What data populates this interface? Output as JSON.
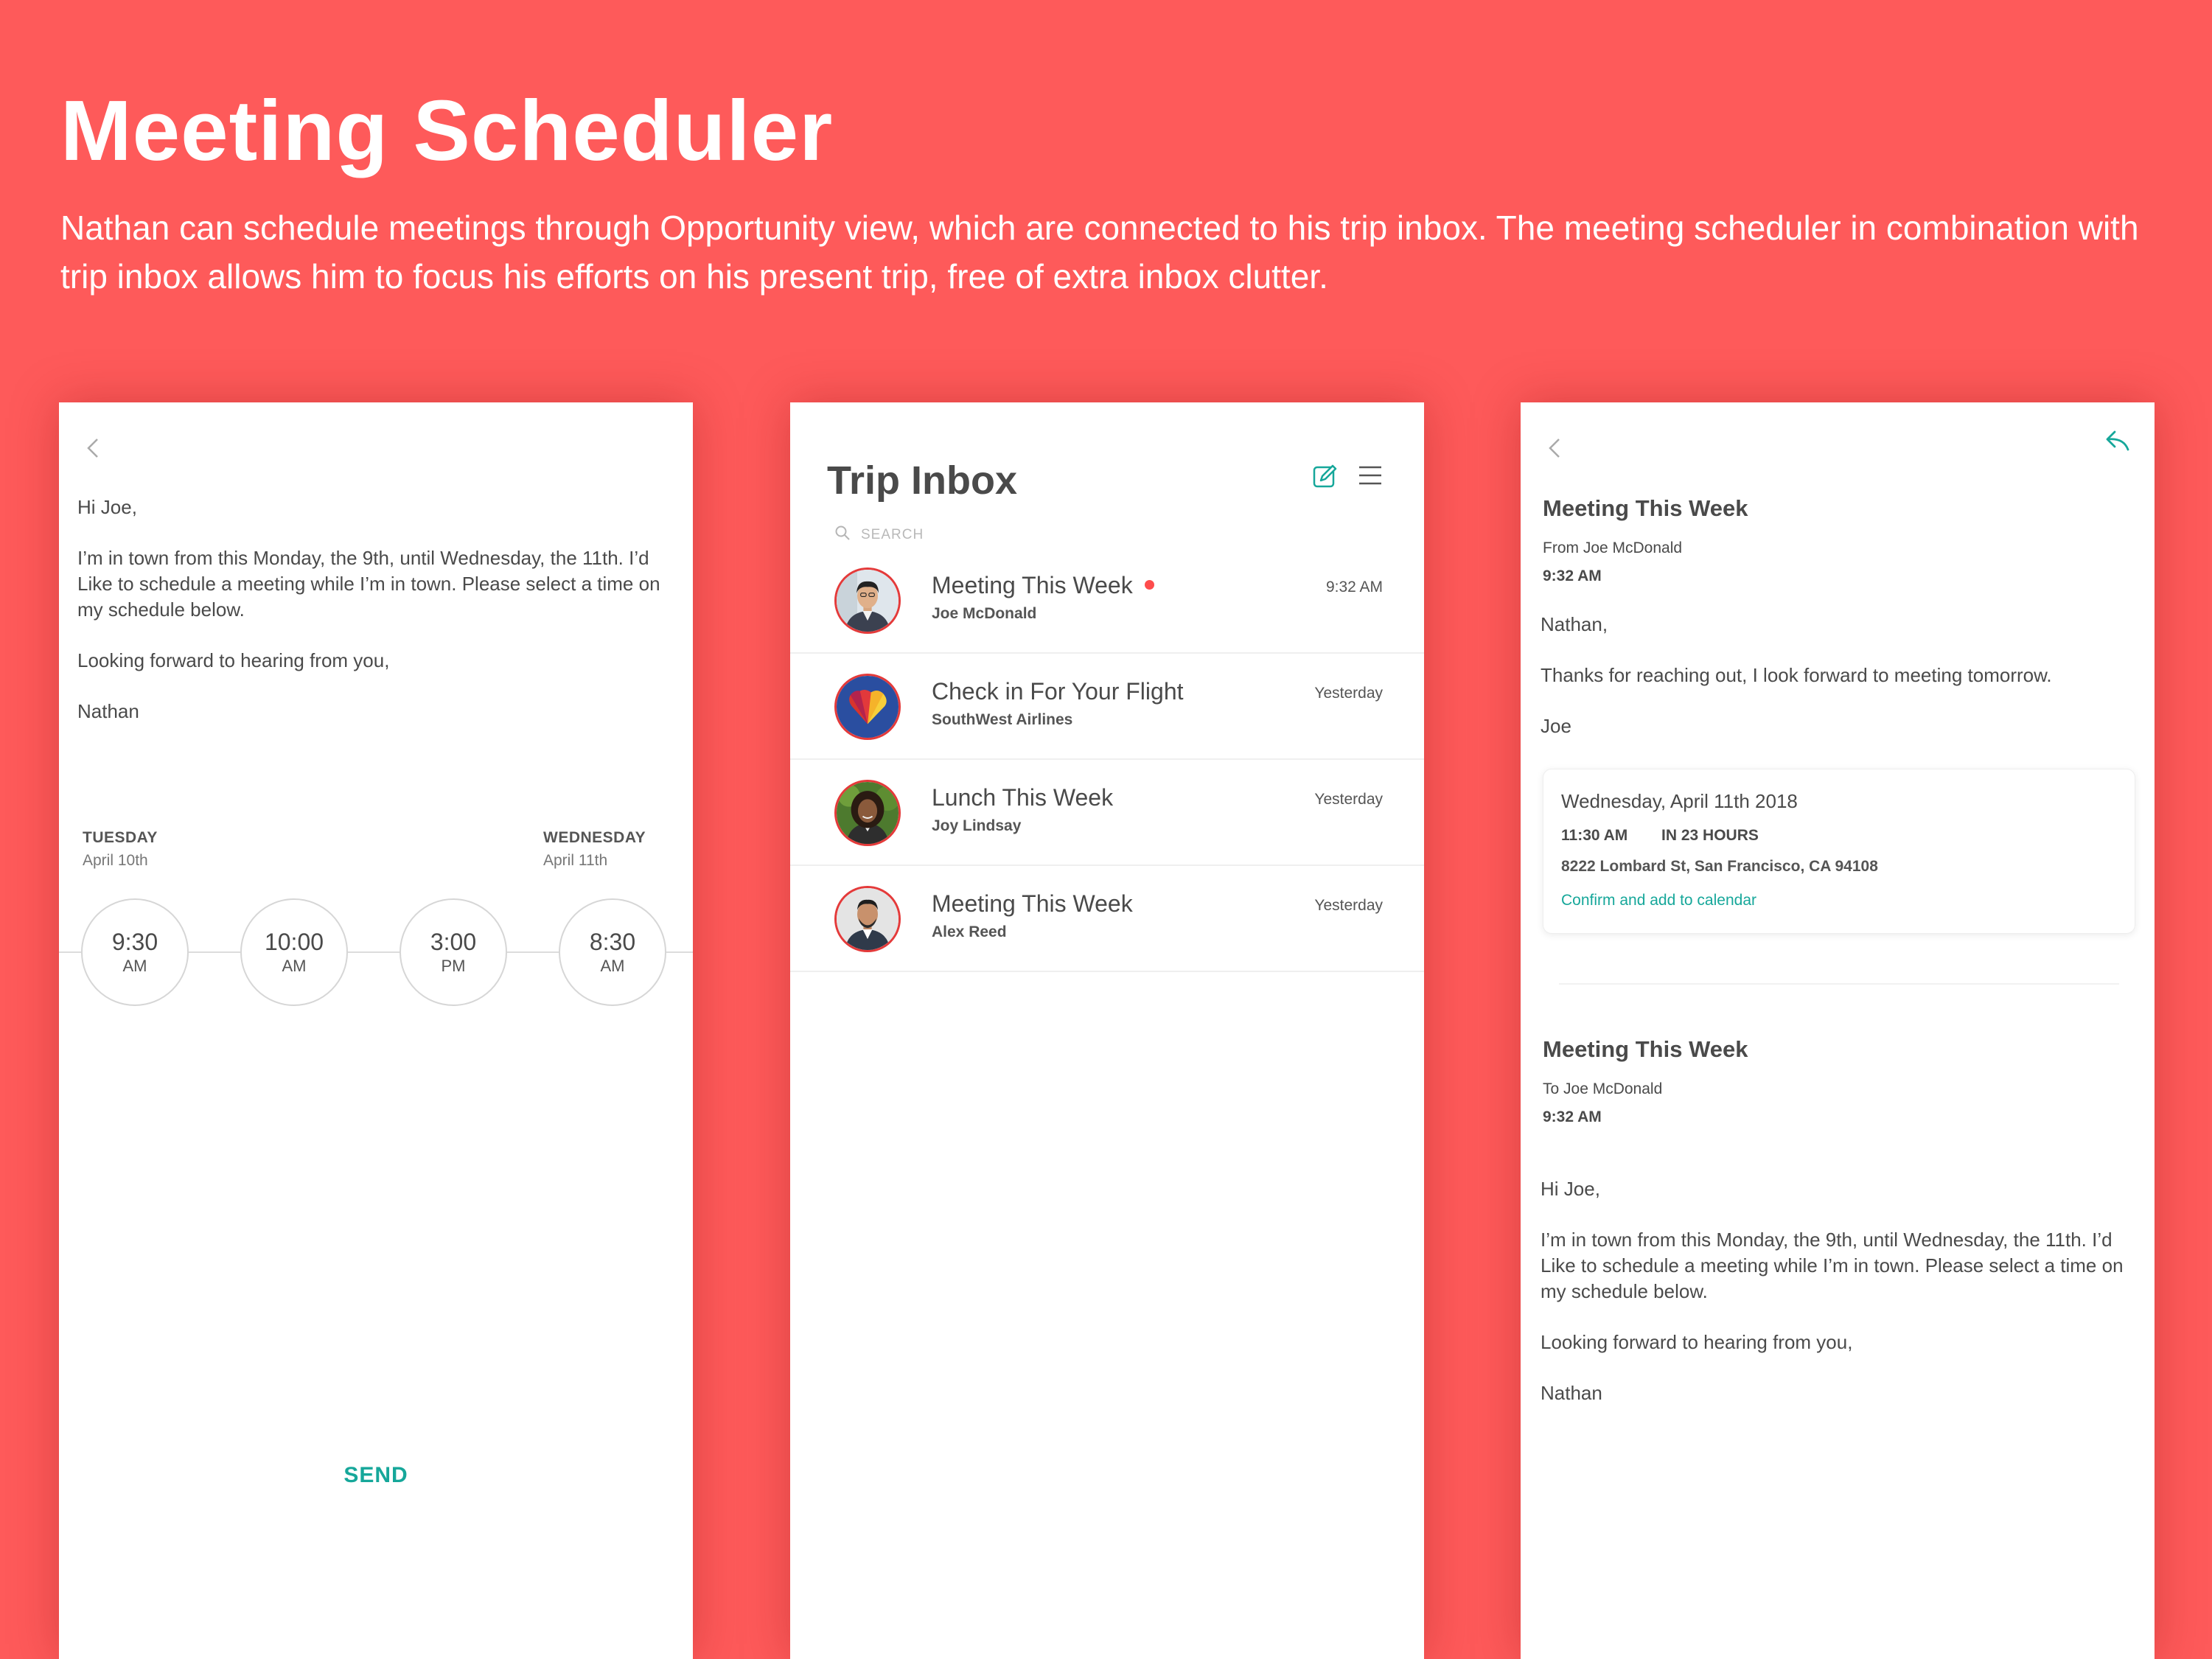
{
  "hero": {
    "title": "Meeting Scheduler",
    "description": "Nathan can schedule meetings through Opportunity view, which are connected to his trip inbox. The meeting scheduler in combination with trip inbox allows him to focus his efforts on his present trip, free of extra inbox clutter."
  },
  "compose_screen": {
    "back_icon": "chevron-left-icon",
    "body": [
      "Hi Joe,",
      "I’m in town from this Monday, the 9th, until Wednesday, the 11th. I’d Like to schedule a meeting while I’m in town. Please select a time on my  schedule below.",
      "Looking forward to hearing from you,",
      "Nathan"
    ],
    "days": [
      {
        "label": "TUESDAY",
        "date": "April 10th"
      },
      {
        "label": "WEDNESDAY",
        "date": "April 11th"
      }
    ],
    "time_slots": [
      {
        "time": "9:30",
        "ampm": "AM"
      },
      {
        "time": "10:00",
        "ampm": "AM"
      },
      {
        "time": "3:00",
        "ampm": "PM"
      },
      {
        "time": "8:30",
        "ampm": "AM"
      }
    ],
    "send_label": "SEND",
    "accent_color": "#16a79a"
  },
  "inbox_screen": {
    "title": "Trip Inbox",
    "compose_icon": "compose-icon",
    "menu_icon": "hamburger-menu-icon",
    "search_placeholder": "SEARCH",
    "messages": [
      {
        "subject": "Meeting This Week",
        "sender": "Joe McDonald",
        "time": "9:32 AM",
        "unread": true
      },
      {
        "subject": "Check in For Your Flight",
        "sender": "SouthWest Airlines",
        "time": "Yesterday",
        "unread": false
      },
      {
        "subject": "Lunch This Week",
        "sender": "Joy Lindsay",
        "time": "Yesterday",
        "unread": false
      },
      {
        "subject": "Meeting This Week",
        "sender": "Alex Reed",
        "time": "Yesterday",
        "unread": false
      }
    ],
    "unread_color": "#fe4c4c"
  },
  "thread_screen": {
    "back_icon": "chevron-left-icon",
    "reply_icon": "reply-icon",
    "first_message": {
      "subject": "Meeting This Week",
      "from": "From Joe McDonald",
      "time": "9:32 AM",
      "body": [
        "Nathan,",
        "Thanks for reaching out, I look forward to meeting tomorrow.",
        "Joe"
      ]
    },
    "event": {
      "date": "Wednesday, April 11th 2018",
      "time": "11:30 AM",
      "countdown": "IN 23 HOURS",
      "address": "8222 Lombard St, San Francisco, CA 94108",
      "confirm_label": "Confirm and add to calendar"
    },
    "second_message": {
      "subject": "Meeting This Week",
      "to": "To Joe McDonald",
      "time": "9:32 AM",
      "body": [
        "Hi Joe,",
        "I’m in town from this Monday, the 9th, until Wednesday, the 11th. I’d Like to schedule a meeting while I’m in town. Please select a time on my  schedule below.",
        "Looking forward to hearing from you,",
        "Nathan"
      ]
    }
  },
  "colors": {
    "background": "#fe5a5a",
    "accent": "#16a79a",
    "text": "#4a4a4a"
  }
}
